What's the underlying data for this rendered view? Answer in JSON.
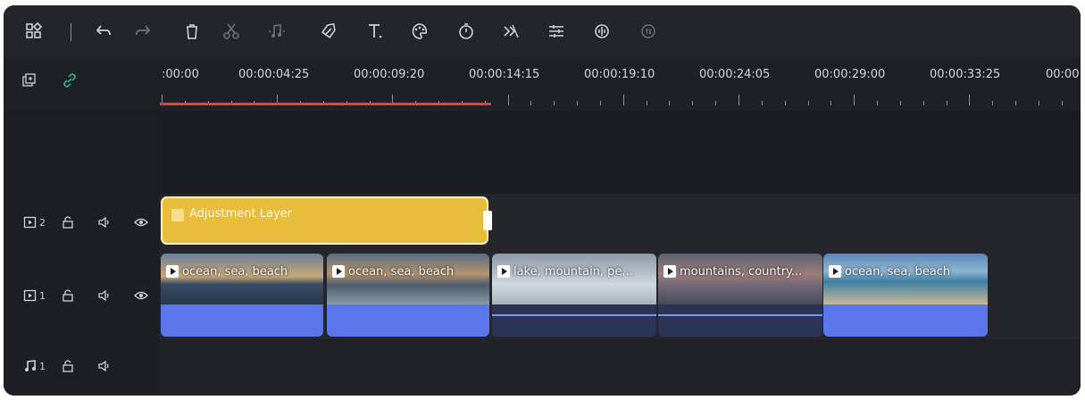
{
  "toolbar": {
    "icons": [
      "layout-icon",
      "undo-icon",
      "redo-icon",
      "delete-icon",
      "cut-icon",
      "audio-icon",
      "tag-icon",
      "text-icon",
      "color-icon",
      "timer-icon",
      "keyframe-icon",
      "adjust-icon",
      "audio-mix-icon",
      "speed-icon"
    ]
  },
  "timeline": {
    "time_labels": [
      ":00:00",
      "00:00:04:25",
      "00:00:09:20",
      "00:00:14:15",
      "00:00:19:10",
      "00:00:24:05",
      "00:00:29:00",
      "00:00:33:25",
      "00:00:"
    ],
    "playhead_color": "#e0443c"
  },
  "tracks": {
    "video2": {
      "number": "2"
    },
    "video1": {
      "number": "1"
    },
    "audio1": {
      "number": "1"
    }
  },
  "clips": {
    "adjustment_label": "Adjustment Layer",
    "items": [
      {
        "label": "ocean, sea, beach",
        "color": "#5b76ea"
      },
      {
        "label": "ocean, sea, beach",
        "color": "#5b76ea"
      },
      {
        "label": "lake, mountain, pe...",
        "color": "#2b3456"
      },
      {
        "label": "mountains, country...",
        "color": "#2b3456"
      },
      {
        "label": "ocean, sea, beach",
        "color": "#5b76ea"
      }
    ]
  },
  "colors": {
    "accent": "#e9bd3c",
    "link": "#2fc48a"
  }
}
